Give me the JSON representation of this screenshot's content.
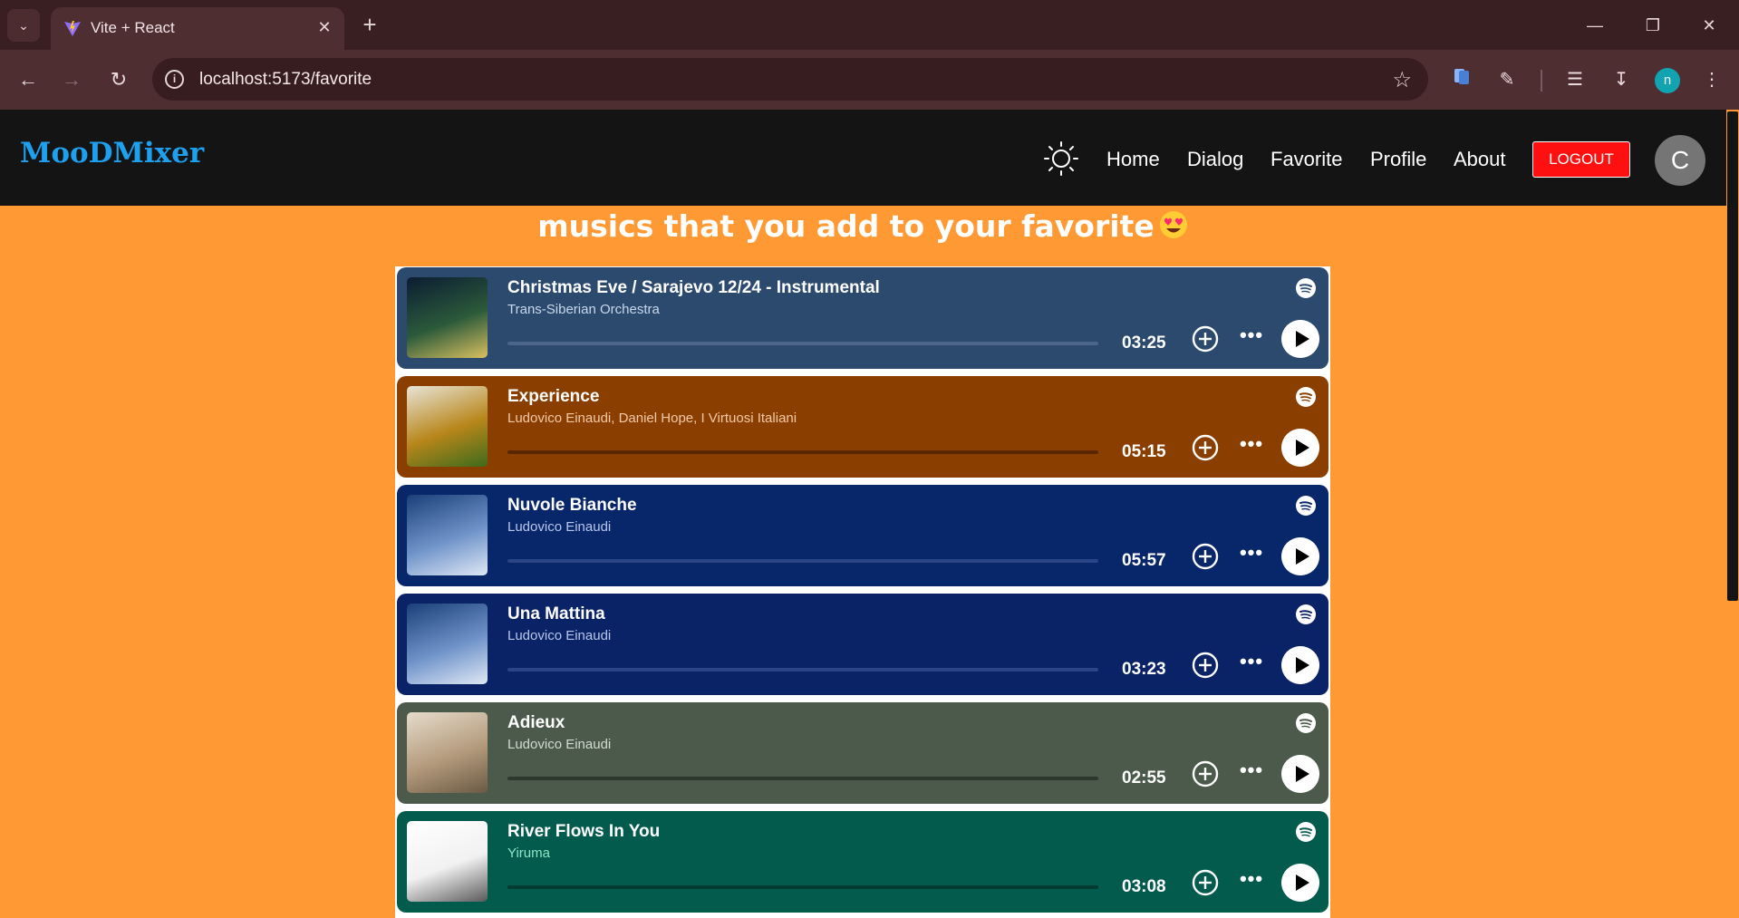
{
  "browser": {
    "tab_title": "Vite + React",
    "url": "localhost:5173/favorite",
    "profile_initial": "n"
  },
  "app": {
    "brand": "MooDMixer",
    "nav": [
      "Home",
      "Dialog",
      "Favorite",
      "Profile",
      "About"
    ],
    "logout_label": "LOGOUT",
    "avatar_initial": "C",
    "theme_icon": "sun-icon"
  },
  "page": {
    "heading": "musics that you add to your favorite",
    "heading_emoji": "heart-eyes-emoji"
  },
  "tracks": [
    {
      "title": "Christmas Eve / Sarajevo 12/24 - Instrumental",
      "artist": "Trans-Siberian Orchestra",
      "duration": "03:25",
      "bg": "#2b4a6e",
      "artist_color": "#c9d8ec",
      "bar": "#4b6689"
    },
    {
      "title": "Experience",
      "artist": "Ludovico Einaudi, Daniel Hope, I Virtuosi Italiani",
      "duration": "05:15",
      "bg": "#8a3f00",
      "artist_color": "#f3c9a8",
      "bar": "#5a2600"
    },
    {
      "title": "Nuvole Bianche",
      "artist": "Ludovico Einaudi",
      "duration": "05:57",
      "bg": "#08276b",
      "artist_color": "#b9c7ea",
      "bar": "#2a4585"
    },
    {
      "title": "Una Mattina",
      "artist": "Ludovico Einaudi",
      "duration": "03:23",
      "bg": "#0a2266",
      "artist_color": "#b9c7ea",
      "bar": "#2a4585"
    },
    {
      "title": "Adieux",
      "artist": "Ludovico Einaudi",
      "duration": "02:55",
      "bg": "#4c5a4b",
      "artist_color": "#d2dbd0",
      "bar": "#2e392d"
    },
    {
      "title": "River Flows In You",
      "artist": "Yiruma",
      "duration": "03:08",
      "bg": "#035b4e",
      "artist_color": "#8fe3c6",
      "bar": "#033a31"
    }
  ]
}
